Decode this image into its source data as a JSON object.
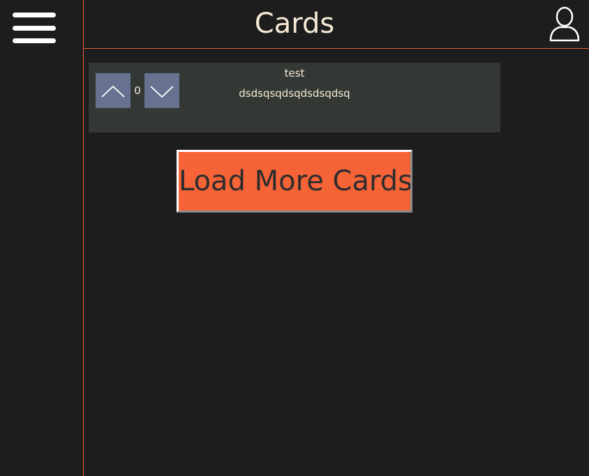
{
  "header": {
    "title": "Cards",
    "menu_icon": "hamburger-menu-icon",
    "profile_icon": "user-profile-icon"
  },
  "cards": [
    {
      "title": "test",
      "body": "dsdsqsqdsqdsdsqdsq",
      "votes": "0",
      "upvote_icon": "chevron-up-icon",
      "downvote_icon": "chevron-down-icon"
    }
  ],
  "load_more": {
    "label": "Load More Cards"
  },
  "colors": {
    "background": "#1c1d1c",
    "accent": "#f05c32",
    "card_background": "#343834",
    "vote_button": "#66728f",
    "load_more_button": "#f56337",
    "text": "#f6e9d6"
  }
}
